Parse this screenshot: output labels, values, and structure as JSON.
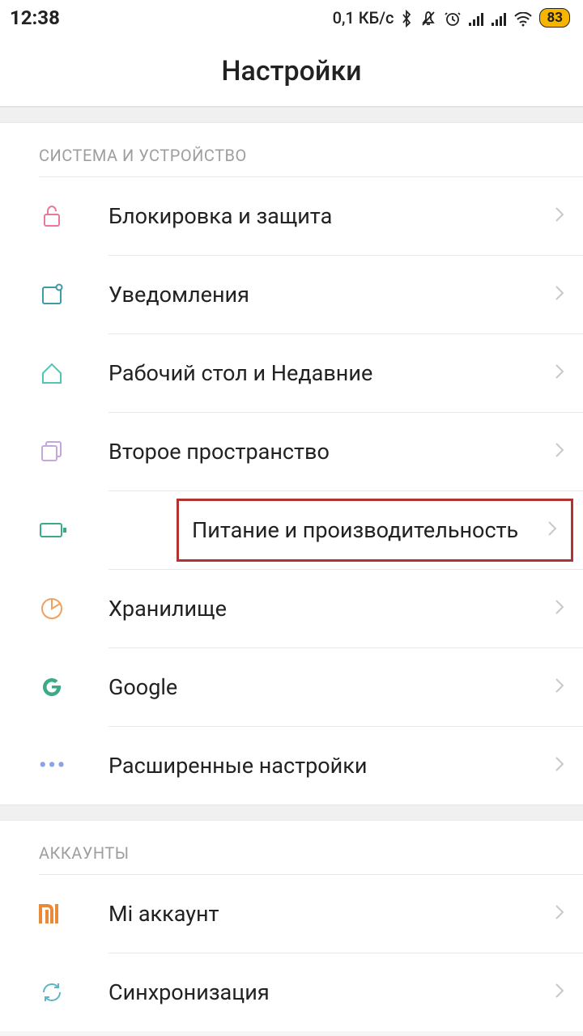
{
  "status": {
    "time": "12:38",
    "data_rate": "0,1 КБ/с",
    "battery": "83"
  },
  "header": {
    "title": "Настройки"
  },
  "sections": {
    "system": {
      "title": "СИСТЕМА И УСТРОЙСТВО",
      "items": {
        "lock": "Блокировка и защита",
        "notifications": "Уведомления",
        "home": "Рабочий стол и Недавние",
        "second_space": "Второе пространство",
        "battery": "Питание и производительность",
        "storage": "Хранилище",
        "google": "Google",
        "advanced": "Расширенные настройки"
      }
    },
    "accounts": {
      "title": "АККАУНТЫ",
      "items": {
        "mi": "Mi аккаунт",
        "sync": "Синхронизация"
      }
    }
  }
}
